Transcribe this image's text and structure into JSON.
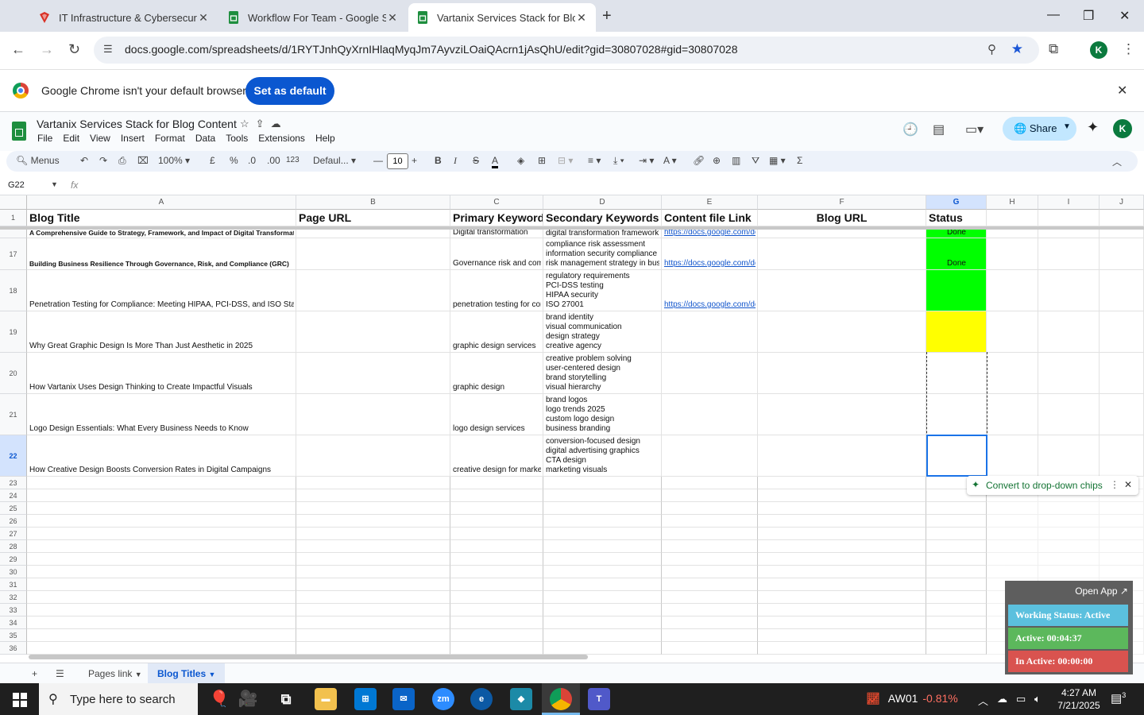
{
  "browser": {
    "tabs": [
      {
        "title": "IT Infrastructure & Cybersecurit",
        "active": false,
        "icon": "red-gem-icon"
      },
      {
        "title": "Workflow For Team - Google Sh",
        "active": false,
        "icon": "sheets-icon"
      },
      {
        "title": "Vartanix Services Stack for Blog",
        "active": true,
        "icon": "sheets-icon"
      }
    ],
    "url": "docs.google.com/spreadsheets/d/1RYTJnhQyXrnIHlaqMyqJm7AyvziLOaiQAcrn1jAsQhU/edit?gid=30807028#gid=30807028",
    "profile_initial": "K"
  },
  "infobar": {
    "message": "Google Chrome isn't your default browser",
    "button": "Set as default"
  },
  "sheets": {
    "title": "Vartanix Services Stack for Blog Content",
    "menus": [
      "File",
      "Edit",
      "View",
      "Insert",
      "Format",
      "Data",
      "Tools",
      "Extensions",
      "Help"
    ],
    "share_label": "Share",
    "profile_initial": "K",
    "toolbar": {
      "menus_label": "Menus",
      "zoom": "100%",
      "currency": "£",
      "percent": "%",
      "dec_decrease": ".0",
      "dec_increase": ".00",
      "number_format": "123",
      "font": "Defaul...",
      "font_size": "10"
    },
    "name_box": "G22",
    "fx_label": "fx"
  },
  "columns": [
    {
      "letter": "A"
    },
    {
      "letter": "B"
    },
    {
      "letter": "C"
    },
    {
      "letter": "D"
    },
    {
      "letter": "E"
    },
    {
      "letter": "F"
    },
    {
      "letter": "G"
    },
    {
      "letter": "H"
    },
    {
      "letter": "I"
    },
    {
      "letter": "J"
    }
  ],
  "header_row": {
    "number": "1",
    "cells": [
      "Blog Title",
      "Page URL",
      "Primary Keyword",
      "Secondary Keywords",
      "Content file Link",
      "Blog URL",
      "Status"
    ]
  },
  "rows": [
    {
      "num": "",
      "title": "A Comprehensive Guide to Strategy, Framework, and Impact of Digital Transformation",
      "title_bold": true,
      "primary": "Digital transformation",
      "secondary": [
        "digital transformation framework"
      ],
      "link": "https://docs.google.com/do",
      "status": "Done",
      "status_color": "#00ff00"
    },
    {
      "num": "17",
      "title": "Building Business Resilience Through Governance, Risk, and Compliance (GRC)",
      "title_bold": true,
      "primary": "Governance risk and com",
      "secondary": [
        "compliance risk assessment",
        "information security compliance",
        "risk management strategy in bus"
      ],
      "link": "https://docs.google.com/do",
      "status": "Done",
      "status_color": "#00ff00"
    },
    {
      "num": "18",
      "title": "Penetration Testing for Compliance: Meeting HIPAA, PCI-DSS, and ISO Sta",
      "title_bold": false,
      "primary": "penetration testing for cor",
      "secondary": [
        "regulatory requirements",
        "PCI-DSS testing",
        "HIPAA security",
        "ISO 27001"
      ],
      "link": "https://docs.google.com/do",
      "status": "",
      "status_color": "#00ff00"
    },
    {
      "num": "19",
      "title": "Why Great Graphic Design Is More Than Just Aesthetic in 2025",
      "title_bold": false,
      "primary": "graphic design services",
      "secondary": [
        "brand identity",
        "visual communication",
        "design strategy",
        "creative agency"
      ],
      "link": "",
      "status": "",
      "status_color": "#ffff00"
    },
    {
      "num": "20",
      "title": "How Vartanix Uses Design Thinking to Create Impactful Visuals",
      "title_bold": false,
      "primary": "graphic design",
      "secondary": [
        "creative problem solving",
        "user-centered design",
        "brand storytelling",
        "visual hierarchy"
      ],
      "link": "",
      "status": "",
      "status_color": ""
    },
    {
      "num": "21",
      "title": "Logo Design Essentials: What Every Business Needs to Know",
      "title_bold": false,
      "primary": "logo design services",
      "secondary": [
        "brand logos",
        "logo trends 2025",
        "custom logo design",
        "business branding"
      ],
      "link": "",
      "status": "",
      "status_color": ""
    },
    {
      "num": "22",
      "title": "How Creative Design Boosts Conversion Rates in Digital Campaigns",
      "title_bold": false,
      "primary": "creative design for market",
      "secondary": [
        "conversion-focused design",
        "digital advertising graphics",
        "CTA design",
        "marketing visuals"
      ],
      "link": "",
      "status": "",
      "status_color": ""
    }
  ],
  "empty_rows": [
    "23",
    "24",
    "25",
    "26",
    "27",
    "28",
    "29",
    "30",
    "31",
    "32",
    "33",
    "34",
    "35",
    "36"
  ],
  "chip_popup": {
    "label": "Convert to drop-down chips"
  },
  "sheet_tabs": [
    {
      "label": "Pages link",
      "active": false
    },
    {
      "label": "Blog Titles",
      "active": true
    }
  ],
  "tracker": {
    "open_app": "Open App ↗",
    "working_status": "Working Status: Active",
    "active": "Active: 00:04:37",
    "inactive": "In Active: 00:00:00",
    "colors": {
      "working": "#5bc0de",
      "active": "#5cb85c",
      "inactive": "#d9534f"
    }
  },
  "taskbar": {
    "search_placeholder": "Type here to search",
    "stock_name": "AW01",
    "stock_change": "-0.81%",
    "time": "4:27 AM",
    "date": "7/21/2025",
    "notifications": "3"
  }
}
